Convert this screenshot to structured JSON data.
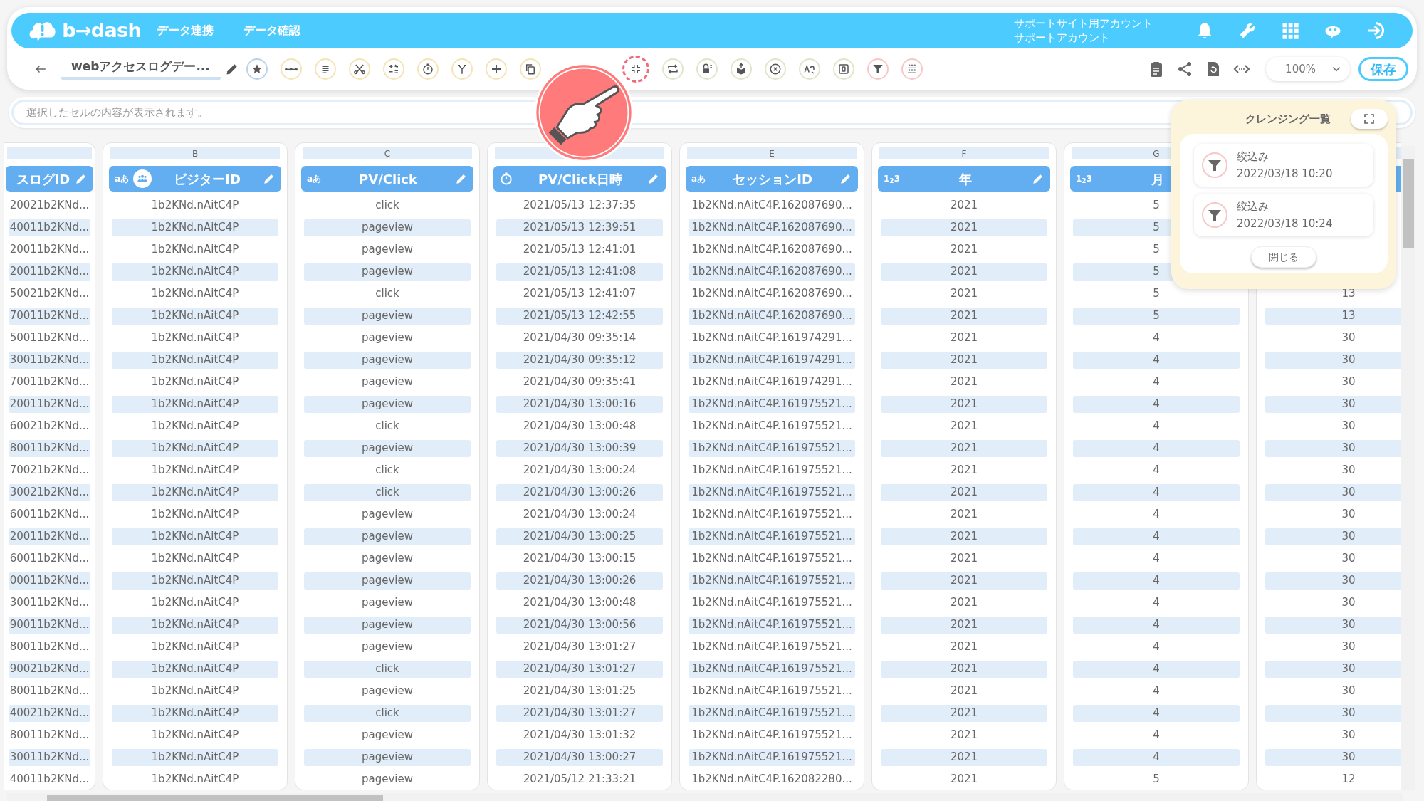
{
  "app": {
    "logo_text": "b→dash",
    "nav": [
      {
        "label": "データ連携"
      },
      {
        "label": "データ確認"
      }
    ],
    "account": {
      "site": "サポートサイト用アカウント",
      "name": "サポートアカウント"
    }
  },
  "toolbar": {
    "title": "webアクセスログデー...",
    "tools": [
      {
        "color": "#b9d3ec",
        "highlighted": false
      },
      {
        "color": "#f6e4b8",
        "highlighted": false
      },
      {
        "color": "#f6e4b8",
        "highlighted": false
      },
      {
        "color": "#f6e4b8",
        "highlighted": false
      },
      {
        "color": "#f6e4b8",
        "highlighted": false
      },
      {
        "color": "#f6e4b8",
        "highlighted": false
      },
      {
        "color": "#f6e4b8",
        "highlighted": false
      },
      {
        "color": "#f6e4b8",
        "highlighted": false
      },
      {
        "color": "#f6e4b8",
        "highlighted": false
      },
      {
        "color": "#f06a78",
        "highlighted": true
      },
      {
        "color": "#dfe7c9",
        "highlighted": false
      },
      {
        "color": "#dfe7c9",
        "highlighted": false
      },
      {
        "color": "#dfe7c9",
        "highlighted": false
      },
      {
        "color": "#dfe7c9",
        "highlighted": false
      },
      {
        "color": "#dfe7c9",
        "highlighted": false
      },
      {
        "color": "#dfe7c9",
        "highlighted": false
      },
      {
        "color": "#f8c7c7",
        "highlighted": false
      },
      {
        "color": "#f8c7c7",
        "highlighted": false
      }
    ],
    "zoom": "100%",
    "save": "保存"
  },
  "cell_viewer": {
    "placeholder": "選択したセルの内容が表示されます。"
  },
  "columns": [
    {
      "label": "スログID",
      "kind": "text",
      "visitor_icon": false
    },
    {
      "letter": "B",
      "label": "ビジターID",
      "kind": "text",
      "badge": "aあ",
      "visitor_icon": true
    },
    {
      "letter": "C",
      "label": "PV/Click",
      "kind": "text",
      "badge": "aあ",
      "visitor_icon": false
    },
    {
      "label": "PV/Click日時",
      "kind": "datetime",
      "visitor_icon": false
    },
    {
      "letter": "E",
      "label": "セッションID",
      "kind": "text",
      "badge": "aあ",
      "visitor_icon": false
    },
    {
      "letter": "F",
      "label": "年",
      "kind": "number",
      "badge": "1$_{2}$3",
      "visitor_icon": false
    },
    {
      "letter": "G",
      "label": "月",
      "kind": "number",
      "badge": "1$_{2}$3",
      "visitor_icon": false
    },
    {
      "kind": "number"
    }
  ],
  "rows": [
    [
      "20021b2KNd...",
      "1b2KNd.nAitC4P",
      "click",
      "2021/05/13 12:37:35",
      "1b2KNd.nAitC4P.162087690...",
      "2021",
      "5"
    ],
    [
      "40011b2KNd...",
      "1b2KNd.nAitC4P",
      "pageview",
      "2021/05/13 12:39:51",
      "1b2KNd.nAitC4P.162087690...",
      "2021",
      "5"
    ],
    [
      "20011b2KNd...",
      "1b2KNd.nAitC4P",
      "pageview",
      "2021/05/13 12:41:01",
      "1b2KNd.nAitC4P.162087690...",
      "2021",
      "5"
    ],
    [
      "20011b2KNd...",
      "1b2KNd.nAitC4P",
      "pageview",
      "2021/05/13 12:41:08",
      "1b2KNd.nAitC4P.162087690...",
      "2021",
      "5"
    ],
    [
      "50021b2KNd...",
      "1b2KNd.nAitC4P",
      "click",
      "2021/05/13 12:41:07",
      "1b2KNd.nAitC4P.162087690...",
      "2021",
      "5",
      "13"
    ],
    [
      "70011b2KNd...",
      "1b2KNd.nAitC4P",
      "pageview",
      "2021/05/13 12:42:55",
      "1b2KNd.nAitC4P.162087690...",
      "2021",
      "5",
      "13"
    ],
    [
      "50011b2KNd...",
      "1b2KNd.nAitC4P",
      "pageview",
      "2021/04/30 09:35:14",
      "1b2KNd.nAitC4P.161974291...",
      "2021",
      "4",
      "30"
    ],
    [
      "30011b2KNd...",
      "1b2KNd.nAitC4P",
      "pageview",
      "2021/04/30 09:35:12",
      "1b2KNd.nAitC4P.161974291...",
      "2021",
      "4",
      "30"
    ],
    [
      "70011b2KNd...",
      "1b2KNd.nAitC4P",
      "pageview",
      "2021/04/30 09:35:41",
      "1b2KNd.nAitC4P.161974291...",
      "2021",
      "4",
      "30"
    ],
    [
      "20011b2KNd...",
      "1b2KNd.nAitC4P",
      "pageview",
      "2021/04/30 13:00:16",
      "1b2KNd.nAitC4P.161975521...",
      "2021",
      "4",
      "30"
    ],
    [
      "60021b2KNd...",
      "1b2KNd.nAitC4P",
      "click",
      "2021/04/30 13:00:48",
      "1b2KNd.nAitC4P.161975521...",
      "2021",
      "4",
      "30"
    ],
    [
      "80011b2KNd...",
      "1b2KNd.nAitC4P",
      "pageview",
      "2021/04/30 13:00:39",
      "1b2KNd.nAitC4P.161975521...",
      "2021",
      "4",
      "30"
    ],
    [
      "70021b2KNd...",
      "1b2KNd.nAitC4P",
      "click",
      "2021/04/30 13:00:24",
      "1b2KNd.nAitC4P.161975521...",
      "2021",
      "4",
      "30"
    ],
    [
      "30021b2KNd...",
      "1b2KNd.nAitC4P",
      "click",
      "2021/04/30 13:00:26",
      "1b2KNd.nAitC4P.161975521...",
      "2021",
      "4",
      "30"
    ],
    [
      "60011b2KNd...",
      "1b2KNd.nAitC4P",
      "pageview",
      "2021/04/30 13:00:24",
      "1b2KNd.nAitC4P.161975521...",
      "2021",
      "4",
      "30"
    ],
    [
      "20011b2KNd...",
      "1b2KNd.nAitC4P",
      "pageview",
      "2021/04/30 13:00:25",
      "1b2KNd.nAitC4P.161975521...",
      "2021",
      "4",
      "30"
    ],
    [
      "60011b2KNd...",
      "1b2KNd.nAitC4P",
      "pageview",
      "2021/04/30 13:00:15",
      "1b2KNd.nAitC4P.161975521...",
      "2021",
      "4",
      "30"
    ],
    [
      "00011b2KNd...",
      "1b2KNd.nAitC4P",
      "pageview",
      "2021/04/30 13:00:26",
      "1b2KNd.nAitC4P.161975521...",
      "2021",
      "4",
      "30"
    ],
    [
      "30011b2KNd...",
      "1b2KNd.nAitC4P",
      "pageview",
      "2021/04/30 13:00:48",
      "1b2KNd.nAitC4P.161975521...",
      "2021",
      "4",
      "30"
    ],
    [
      "90011b2KNd...",
      "1b2KNd.nAitC4P",
      "pageview",
      "2021/04/30 13:00:56",
      "1b2KNd.nAitC4P.161975521...",
      "2021",
      "4",
      "30"
    ],
    [
      "80011b2KNd...",
      "1b2KNd.nAitC4P",
      "pageview",
      "2021/04/30 13:01:27",
      "1b2KNd.nAitC4P.161975521...",
      "2021",
      "4",
      "30"
    ],
    [
      "90021b2KNd...",
      "1b2KNd.nAitC4P",
      "click",
      "2021/04/30 13:01:27",
      "1b2KNd.nAitC4P.161975521...",
      "2021",
      "4",
      "30"
    ],
    [
      "80011b2KNd...",
      "1b2KNd.nAitC4P",
      "pageview",
      "2021/04/30 13:01:25",
      "1b2KNd.nAitC4P.161975521...",
      "2021",
      "4",
      "30"
    ],
    [
      "40021b2KNd...",
      "1b2KNd.nAitC4P",
      "click",
      "2021/04/30 13:01:27",
      "1b2KNd.nAitC4P.161975521...",
      "2021",
      "4",
      "30"
    ],
    [
      "80011b2KNd...",
      "1b2KNd.nAitC4P",
      "pageview",
      "2021/04/30 13:01:32",
      "1b2KNd.nAitC4P.161975521...",
      "2021",
      "4",
      "30"
    ],
    [
      "30011b2KNd...",
      "1b2KNd.nAitC4P",
      "pageview",
      "2021/04/30 13:00:27",
      "1b2KNd.nAitC4P.161975521...",
      "2021",
      "4",
      "30"
    ],
    [
      "40011b2KNd...",
      "1b2KNd.nAitC4P",
      "pageview",
      "2021/05/12 21:33:21",
      "1b2KNd.nAitC4P.162082280...",
      "2021",
      "5",
      "12"
    ]
  ],
  "cleansing_panel": {
    "title": "クレンジング一覧",
    "items": [
      {
        "kind": "filter",
        "label": "絞込み",
        "time": "2022/03/18 10:20"
      },
      {
        "kind": "filter",
        "label": "絞込み",
        "time": "2022/03/18 10:24"
      }
    ],
    "close": "閉じる"
  }
}
